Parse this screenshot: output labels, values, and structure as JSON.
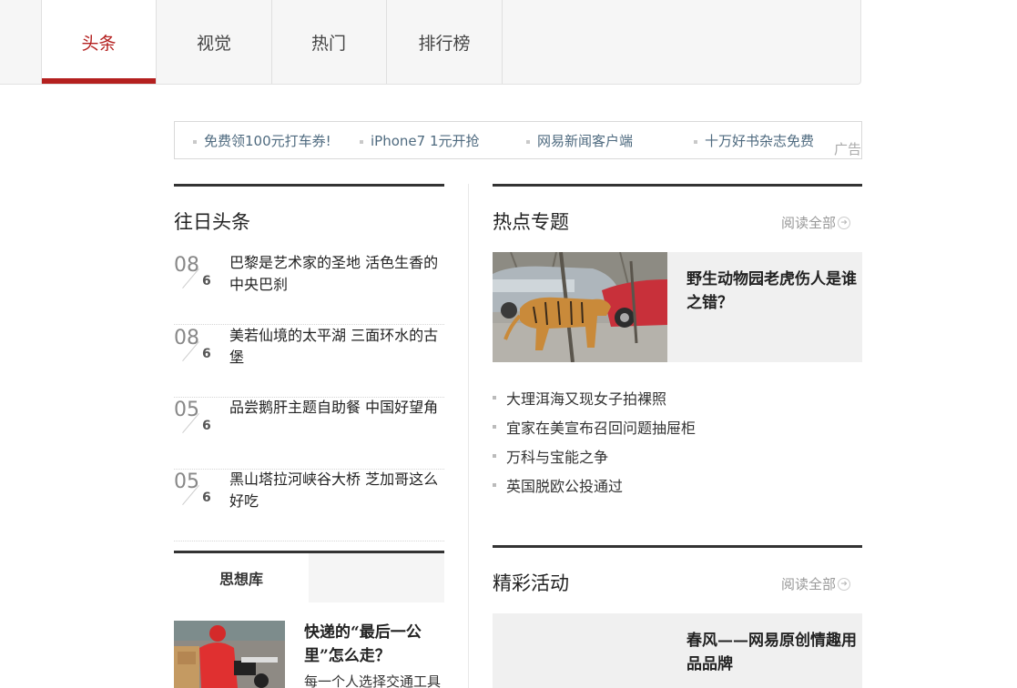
{
  "nav": {
    "tabs": [
      {
        "label": "头条",
        "active": true
      },
      {
        "label": "视觉",
        "active": false
      },
      {
        "label": "热门",
        "active": false
      },
      {
        "label": "排行榜",
        "active": false
      }
    ]
  },
  "ads": {
    "items": [
      "免费领100元打车券!",
      "iPhone7 1元开抢",
      "网易新闻客户端",
      "十万好书杂志免费"
    ],
    "tag": "广告"
  },
  "past": {
    "title": "往日头条",
    "items": [
      {
        "month": "08",
        "day": "6",
        "text": "巴黎是艺术家的圣地 活色生香的中央巴刹"
      },
      {
        "month": "08",
        "day": "6",
        "text": "美若仙境的太平湖 三面环水的古堡"
      },
      {
        "month": "05",
        "day": "6",
        "text": "品尝鹅肝主题自助餐 中国好望角"
      },
      {
        "month": "05",
        "day": "6",
        "text": "黑山塔拉河峡谷大桥 芝加哥这么好吃"
      }
    ]
  },
  "hot": {
    "title": "热点专题",
    "read_all": "阅读全部",
    "feature_title": "野生动物园老虎伤人是谁之错？",
    "list": [
      "大理洱海又现女子拍裸照",
      "宜家在美宣布召回问题抽屉柜",
      "万科与宝能之争",
      "英国脱欧公投通过"
    ]
  },
  "think": {
    "tab": "思想库",
    "title": "快递的“最后一公里”怎么走？",
    "sub": "每一个人选择交通工具"
  },
  "activity": {
    "title": "精彩活动",
    "read_all": "阅读全部",
    "feature_title": "春风——网易原创情趣用品品牌"
  },
  "colors": {
    "accent": "#b4201f",
    "link": "#4e6a7f"
  }
}
